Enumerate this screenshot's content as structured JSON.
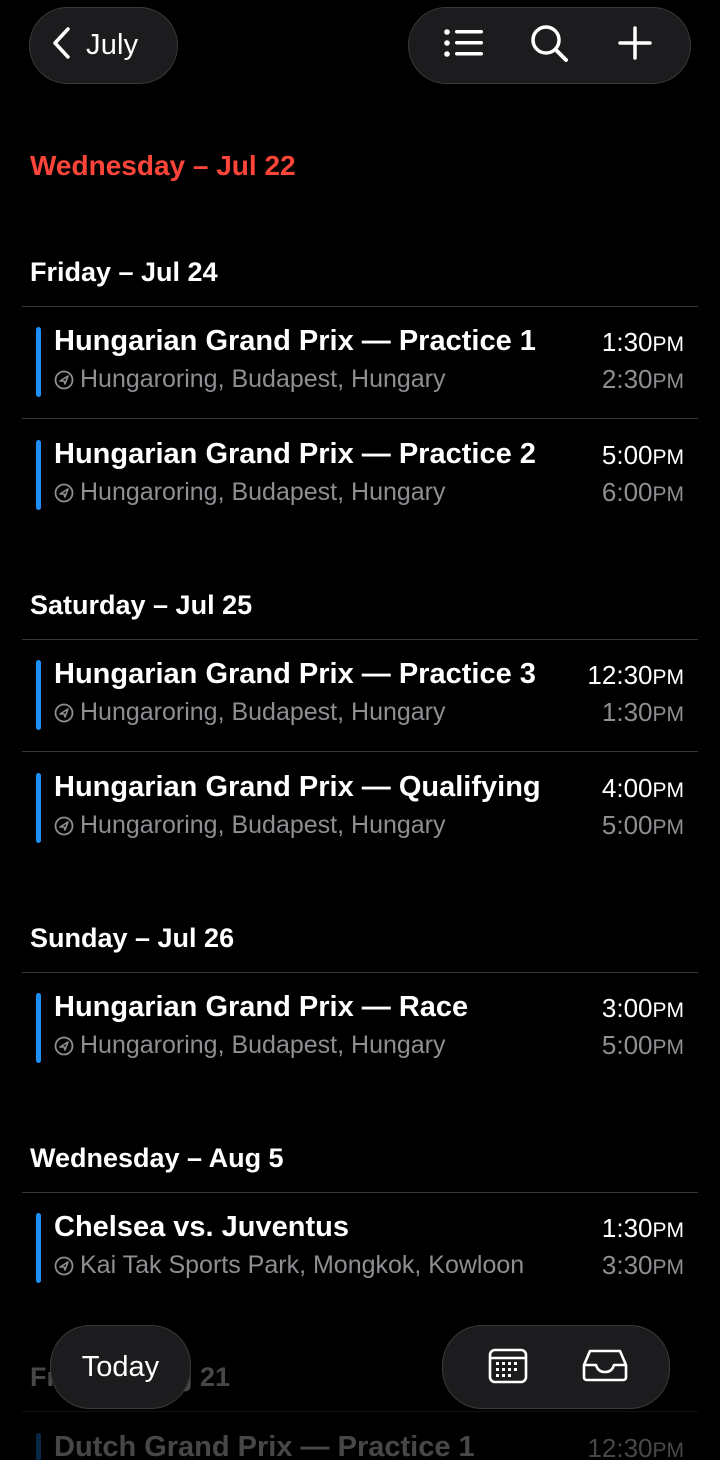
{
  "nav": {
    "back_label": "July",
    "icons": [
      "chevron-left-icon",
      "list-icon",
      "search-icon",
      "plus-icon"
    ]
  },
  "sections": [
    {
      "header": "Wednesday – Jul 22",
      "is_today": true,
      "events": []
    },
    {
      "header": "Friday – Jul 24",
      "events": [
        {
          "title": "Hungarian Grand Prix — Practice 1",
          "location": "Hungaroring, Budapest, Hungary",
          "start": "1:30",
          "start_ampm": "PM",
          "end": "2:30",
          "end_ampm": "PM"
        },
        {
          "title": "Hungarian Grand Prix — Practice 2",
          "location": "Hungaroring, Budapest, Hungary",
          "start": "5:00",
          "start_ampm": "PM",
          "end": "6:00",
          "end_ampm": "PM"
        }
      ]
    },
    {
      "header": "Saturday – Jul 25",
      "events": [
        {
          "title": "Hungarian Grand Prix — Practice 3",
          "location": "Hungaroring, Budapest, Hungary",
          "start": "12:30",
          "start_ampm": "PM",
          "end": "1:30",
          "end_ampm": "PM"
        },
        {
          "title": "Hungarian Grand Prix — Qualifying",
          "location": "Hungaroring, Budapest, Hungary",
          "start": "4:00",
          "start_ampm": "PM",
          "end": "5:00",
          "end_ampm": "PM"
        }
      ]
    },
    {
      "header": "Sunday – Jul 26",
      "events": [
        {
          "title": "Hungarian Grand Prix — Race",
          "location": "Hungaroring, Budapest, Hungary",
          "start": "3:00",
          "start_ampm": "PM",
          "end": "5:00",
          "end_ampm": "PM"
        }
      ]
    },
    {
      "header": "Wednesday – Aug 5",
      "events": [
        {
          "title": "Chelsea vs. Juventus",
          "location": "Kai Tak Sports Park, Mongkok, Kowloon",
          "start": "1:30",
          "start_ampm": "PM",
          "end": "3:30",
          "end_ampm": "PM"
        }
      ]
    },
    {
      "header": "Friday – Aug 21",
      "partially_hidden": true,
      "events": [
        {
          "title": "Dutch Grand Prix — Practice 1",
          "start": "12:30",
          "start_ampm": "PM"
        }
      ]
    }
  ],
  "toolbar": {
    "today_label": "Today",
    "icons": [
      "calendar-grid-icon",
      "inbox-icon"
    ]
  },
  "colors": {
    "today_red": "#ff453a",
    "event_blue": "#1e8ff7",
    "secondary_text": "#8e8e93",
    "pill_bg": "#1c1c1e"
  }
}
